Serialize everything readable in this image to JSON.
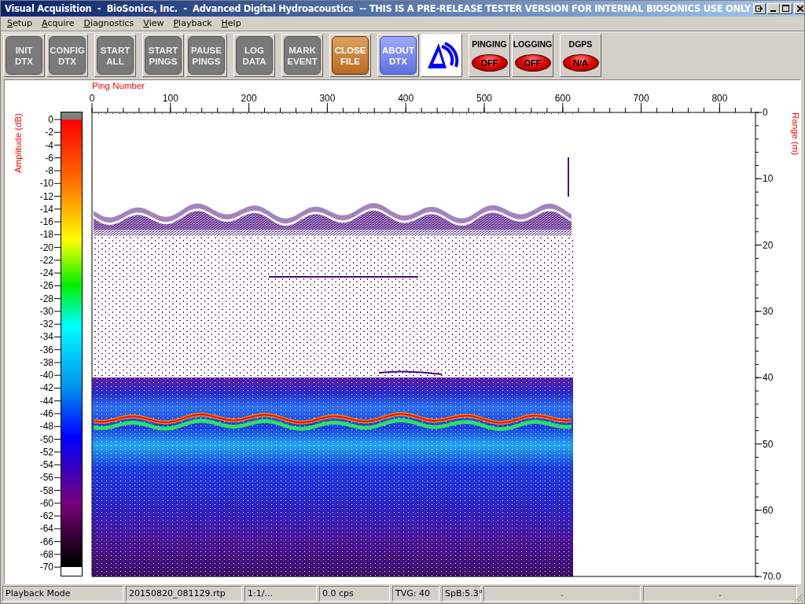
{
  "window": {
    "title": "Visual Acquisition  -  BioSonics, Inc.  -  Advanced Digital Hydroacoustics  -- THIS IS A PRE-RELEASE TESTER VERSION FOR INTERNAL BIOSONICS USE ONLY"
  },
  "menu": [
    "Setup",
    "Acquire",
    "Diagnostics",
    "View",
    "Playback",
    "Help"
  ],
  "toolbar": [
    [
      {
        "kind": "grey",
        "label": "INIT DTX"
      },
      {
        "kind": "grey",
        "label": "CONFIG DTX"
      }
    ],
    [
      {
        "kind": "grey",
        "label": "START ALL"
      }
    ],
    [
      {
        "kind": "grey",
        "label": "START PINGS"
      },
      {
        "kind": "grey",
        "label": "PAUSE PINGS"
      }
    ],
    [
      {
        "kind": "grey",
        "label": "LOG DATA"
      }
    ],
    [
      {
        "kind": "grey",
        "label": "MARK EVENT"
      }
    ],
    [
      {
        "kind": "orange",
        "label": "CLOSE FILE"
      }
    ],
    [
      {
        "kind": "blue",
        "label": "ABOUT DTX"
      },
      {
        "kind": "logo"
      }
    ],
    [
      {
        "kind": "indicator",
        "label": "PINGING",
        "value": "OFF"
      },
      {
        "kind": "indicator",
        "label": "LOGGING",
        "value": "OFF"
      }
    ],
    [
      {
        "kind": "indicator",
        "label": "DGPS",
        "value": "N/A"
      }
    ]
  ],
  "echogram": {
    "x_axis_title": "Ping Number",
    "x_ticks": [
      "0",
      "100",
      "200",
      "300",
      "400",
      "500",
      "600",
      "700",
      "800"
    ],
    "y_axis_title": "Range (m)",
    "y_ticks": [
      "0",
      "10",
      "20",
      "30",
      "40",
      "50",
      "60",
      "70.0"
    ],
    "color_scale": {
      "title": "Amplitude (dB)",
      "ticks": [
        "0",
        "-2",
        "-4",
        "-6",
        "-8",
        "-10",
        "-12",
        "-14",
        "-16",
        "-18",
        "-20",
        "-22",
        "-24",
        "-26",
        "-28",
        "-30",
        "-32",
        "-34",
        "-36",
        "-38",
        "-40",
        "-42",
        "-44",
        "-46",
        "-48",
        "-50",
        "-52",
        "-54",
        "-56",
        "-58",
        "-60",
        "-62",
        "-64",
        "-66",
        "-68",
        "-70"
      ]
    }
  },
  "status_bar": [
    "Playback Mode",
    "20150820_081129.rtp",
    "1:1/...",
    "0.0 cps",
    "TVG: 40",
    "SpB:5.3°",
    ".",
    "."
  ]
}
